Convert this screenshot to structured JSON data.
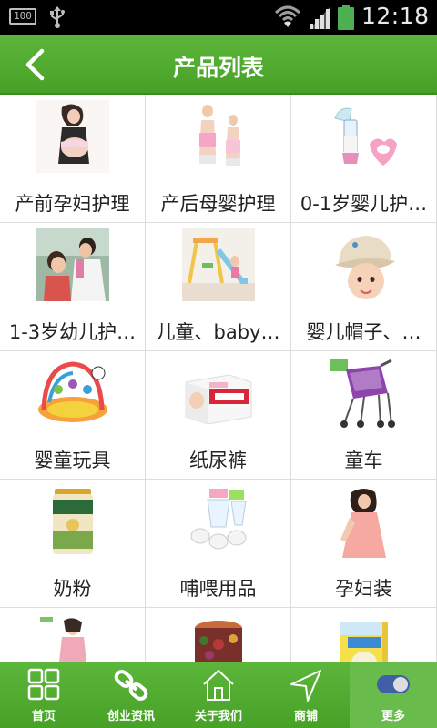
{
  "status_bar": {
    "battery_box_text": "100",
    "time": "12:18",
    "icons": [
      "battery-100-icon",
      "usb-icon",
      "wifi-icon",
      "signal-icon",
      "battery-icon"
    ]
  },
  "header": {
    "title": "产品列表",
    "back_icon": "chevron-left-icon"
  },
  "colors": {
    "brand_green": "#4fa92e",
    "active_tab": "#69bb4c",
    "grid_line": "#dddddd"
  },
  "products": [
    {
      "label": "产前孕妇护理",
      "image": "pregnant-woman-photo"
    },
    {
      "label": "产后母婴护理",
      "image": "postpartum-belt-photo"
    },
    {
      "label": "0-1岁婴儿护…",
      "image": "breast-pump-photo"
    },
    {
      "label": "1-3岁幼儿护…",
      "image": "child-doctor-photo"
    },
    {
      "label": "儿童、baby…",
      "image": "slide-swing-photo"
    },
    {
      "label": "婴儿帽子、…",
      "image": "baby-hat-photo"
    },
    {
      "label": "婴童玩具",
      "image": "play-gym-photo"
    },
    {
      "label": "纸尿裤",
      "image": "diaper-box-photo"
    },
    {
      "label": "童车",
      "image": "stroller-photo"
    },
    {
      "label": "奶粉",
      "image": "milk-powder-can-photo"
    },
    {
      "label": "哺喂用品",
      "image": "feeding-supplies-photo"
    },
    {
      "label": "孕妇装",
      "image": "maternity-dress-photo"
    },
    {
      "label": "",
      "image": "maternity-clothes-photo"
    },
    {
      "label": "",
      "image": "snack-jar-photo"
    },
    {
      "label": "",
      "image": "baby-food-box-photo"
    }
  ],
  "bottom_nav": [
    {
      "label": "首页",
      "icon": "grid-icon",
      "active": false
    },
    {
      "label": "创业资讯",
      "icon": "link-icon",
      "active": false
    },
    {
      "label": "关于我们",
      "icon": "home-icon",
      "active": false
    },
    {
      "label": "商铺",
      "icon": "navigation-arrow-icon",
      "active": false
    },
    {
      "label": "更多",
      "icon": "toggle-icon",
      "active": true
    }
  ]
}
